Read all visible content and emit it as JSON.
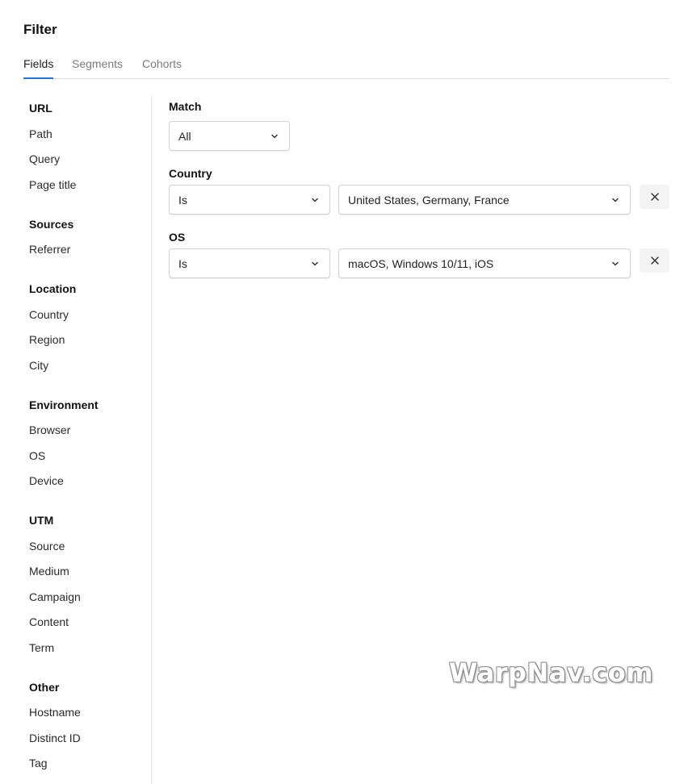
{
  "header": {
    "title": "Filter"
  },
  "tabs": [
    {
      "label": "Fields",
      "active": true
    },
    {
      "label": "Segments",
      "active": false
    },
    {
      "label": "Cohorts",
      "active": false
    }
  ],
  "sidebar": {
    "groups": [
      {
        "title": "URL",
        "items": [
          "Path",
          "Query",
          "Page title"
        ]
      },
      {
        "title": "Sources",
        "items": [
          "Referrer"
        ]
      },
      {
        "title": "Location",
        "items": [
          "Country",
          "Region",
          "City"
        ]
      },
      {
        "title": "Environment",
        "items": [
          "Browser",
          "OS",
          "Device"
        ]
      },
      {
        "title": "UTM",
        "items": [
          "Source",
          "Medium",
          "Campaign",
          "Content",
          "Term"
        ]
      },
      {
        "title": "Other",
        "items": [
          "Hostname",
          "Distinct ID",
          "Tag"
        ]
      }
    ]
  },
  "match": {
    "label": "Match",
    "value": "All"
  },
  "filters": [
    {
      "label": "Country",
      "operator": "Is",
      "value": "United States, Germany, France"
    },
    {
      "label": "OS",
      "operator": "Is",
      "value": "macOS, Windows 10/11, iOS"
    }
  ],
  "icons": {
    "chevron": "chevron-down-icon",
    "remove": "close-icon"
  },
  "colors": {
    "accent": "#1a73e8"
  },
  "watermark": "WarpNav.com"
}
